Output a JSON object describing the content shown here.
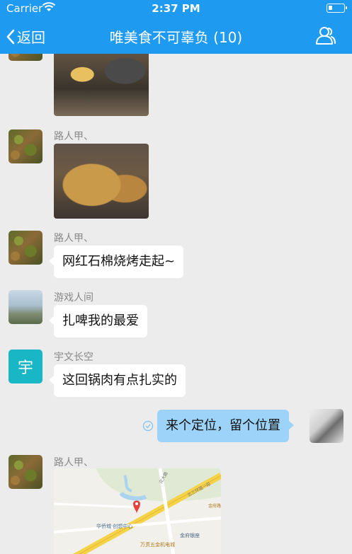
{
  "status_bar": {
    "carrier": "Carrier",
    "time": "2:37 PM"
  },
  "nav": {
    "back_label": "返回",
    "title": "唯美食不可辜负 (10)"
  },
  "messages": [
    {
      "type": "image",
      "sender": ""
    },
    {
      "type": "image",
      "sender": "路人甲、"
    },
    {
      "type": "text",
      "sender": "路人甲、",
      "text": "网红石棉烧烤走起~"
    },
    {
      "type": "text",
      "sender": "游戏人间",
      "text": "扎啤我的最爱"
    },
    {
      "type": "text",
      "sender": "宇文长空",
      "avatar_letter": "宇",
      "text": "这回锅肉有点扎实的"
    },
    {
      "type": "text",
      "sender": "self",
      "text": "来个定位，留个位置"
    },
    {
      "type": "location",
      "sender": "路人甲、",
      "map_labels": [
        "华侨城·创想中心",
        "万贯五金机电城",
        "金府银座",
        "北三环路一段",
        "金府路",
        "交大路"
      ]
    }
  ],
  "icons": {
    "back": "chevron-left-icon",
    "group": "group-members-icon",
    "wifi": "wifi-icon",
    "battery": "battery-icon",
    "sent": "sent-check-icon",
    "pin": "location-pin-icon"
  },
  "colors": {
    "header": "#1e9af0",
    "self_bubble": "#9dd3f8",
    "background": "#ececec"
  }
}
